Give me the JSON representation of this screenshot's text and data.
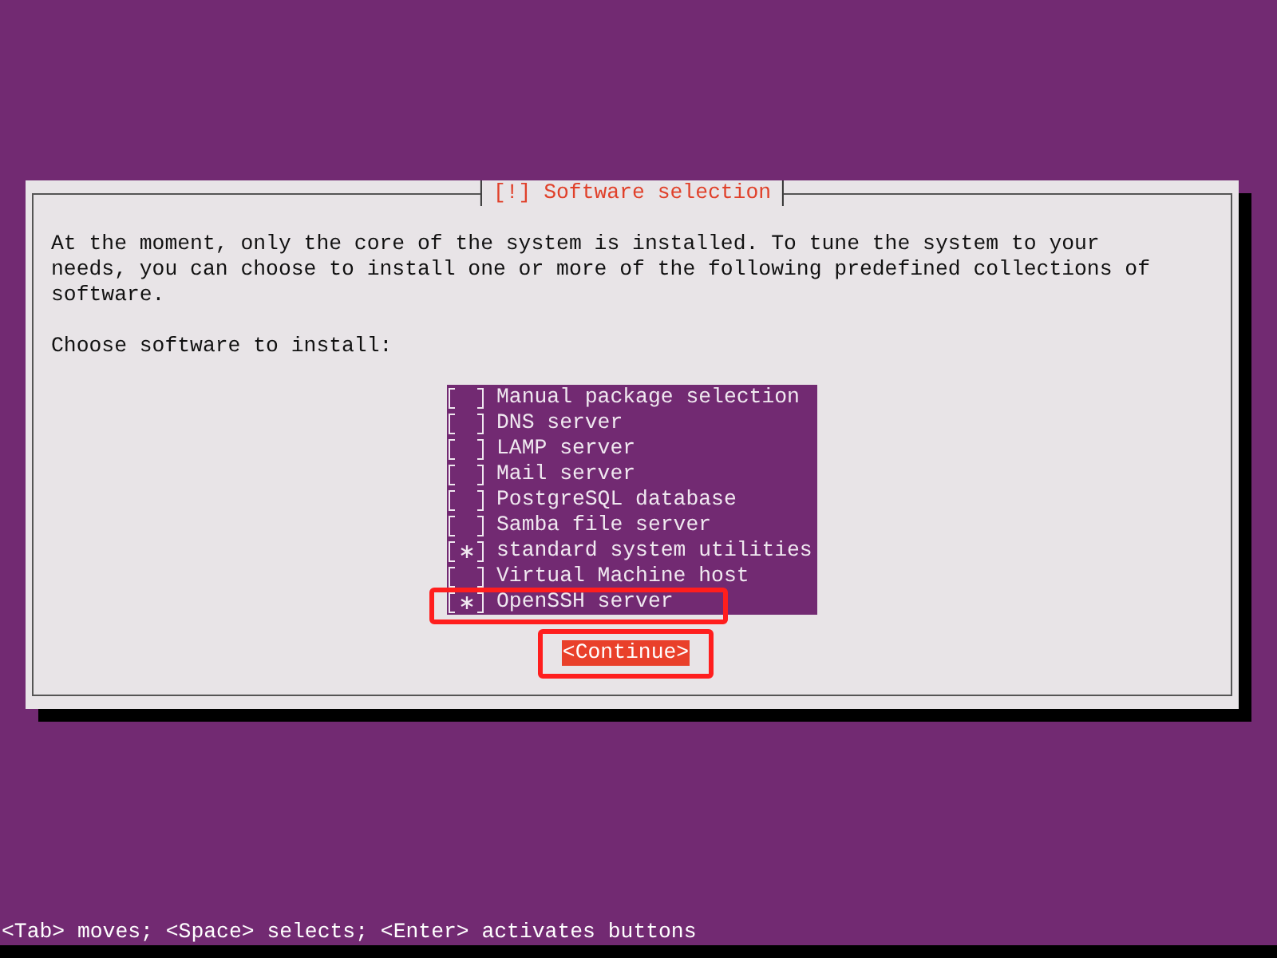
{
  "dialog": {
    "title": "[!] Software selection",
    "description": "At the moment, only the core of the system is installed. To tune the system to your needs, you can choose to install one or more of the following predefined collections of software.",
    "prompt": "Choose software to install:",
    "options": [
      {
        "label": "Manual package selection",
        "checked": false,
        "highlighted": false
      },
      {
        "label": "DNS server",
        "checked": false,
        "highlighted": false
      },
      {
        "label": "LAMP server",
        "checked": false,
        "highlighted": false
      },
      {
        "label": "Mail server",
        "checked": false,
        "highlighted": false
      },
      {
        "label": "PostgreSQL database",
        "checked": false,
        "highlighted": false
      },
      {
        "label": "Samba file server",
        "checked": false,
        "highlighted": false
      },
      {
        "label": "standard system utilities",
        "checked": true,
        "highlighted": false
      },
      {
        "label": "Virtual Machine host",
        "checked": false,
        "highlighted": false
      },
      {
        "label": "OpenSSH server",
        "checked": true,
        "highlighted": true
      }
    ],
    "continue_button": {
      "label": "<Continue>",
      "focused": true,
      "highlighted": true
    }
  },
  "status_bar": "<Tab> moves; <Space> selects; <Enter> activates buttons"
}
